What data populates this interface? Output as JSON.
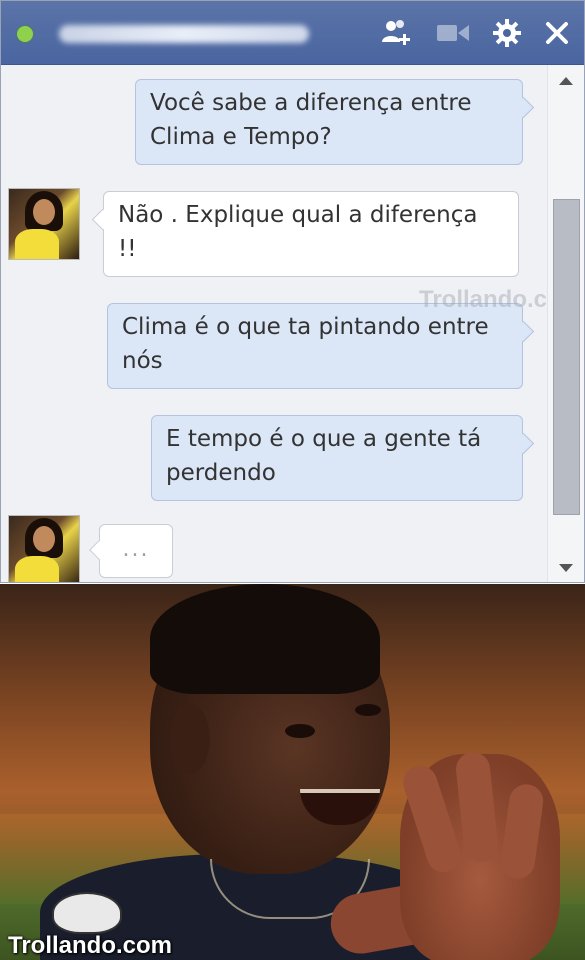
{
  "chat_window": {
    "contact_status": "online",
    "colors": {
      "titlebar": "#4a65a0",
      "sent_bubble": "#dbe6f6",
      "received_bubble": "#ffffff",
      "online": "#8fd14d"
    },
    "titlebar_icons": [
      "add-friend-icon",
      "video-call-icon",
      "gear-icon",
      "close-icon"
    ]
  },
  "messages": [
    {
      "direction": "sent",
      "line1": "Você sabe a diferença entre",
      "line2": "Clima e Tempo?"
    },
    {
      "direction": "received",
      "line1": "Não . Explique qual a diferença",
      "line2": "!!"
    },
    {
      "direction": "sent",
      "line1": "Clima é o que ta pintando entre",
      "line2": "nós"
    },
    {
      "direction": "sent",
      "line1": "E tempo é o que a gente tá",
      "line2": "perdendo"
    }
  ],
  "typing_indicator": "...",
  "watermarks": {
    "chat": "Trollando.com",
    "photo": "Trollando.com"
  }
}
